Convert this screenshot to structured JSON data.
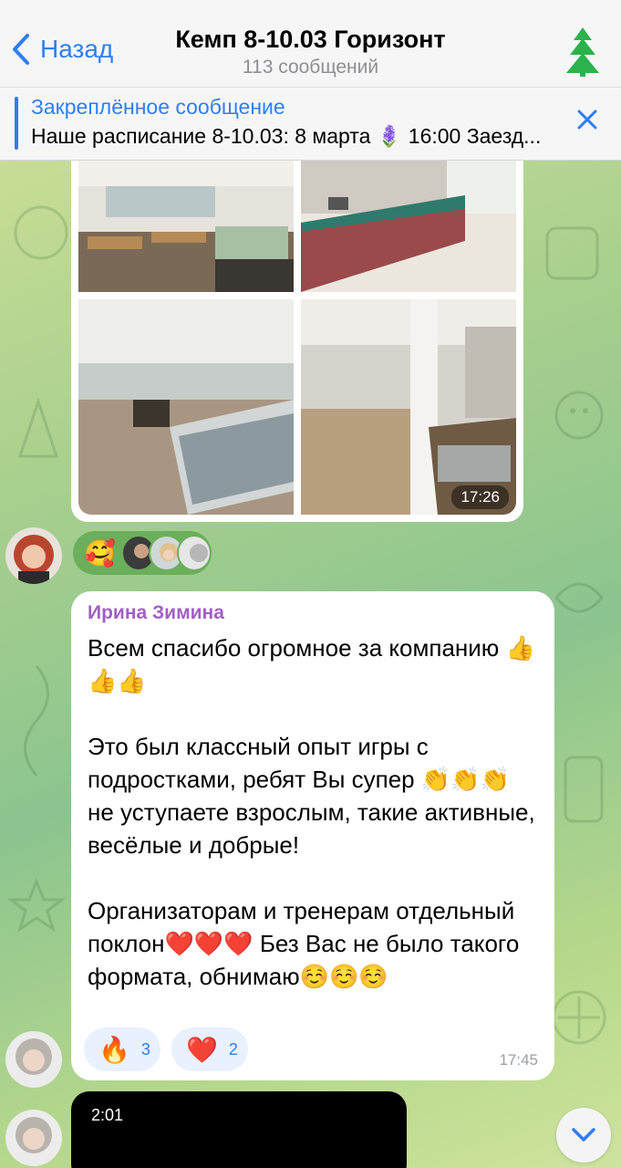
{
  "header": {
    "back_label": "Назад",
    "title": "Кемп 8-10.03 Горизонт",
    "subtitle": "113 сообщений"
  },
  "pinned": {
    "label": "Закреплённое сообщение",
    "text": "Наше расписание 8-10.03: 8 марта 🪻 16:00 Заезд..."
  },
  "album": {
    "time": "17:26"
  },
  "album_reactions": {
    "emoji": "🥰"
  },
  "message": {
    "sender": "Ирина Зимина",
    "text": "Всем спасибо огромное за компанию 👍👍👍\n\nЭто был классный опыт игры с подростками, ребят Вы супер 👏👏👏 не уступаете взрослым, такие активные, весёлые и добрые!\n\nОрганизаторам и тренерам отдельный поклон❤️❤️❤️ Без Вас не было такого формата, обнимаю☺️☺️☺️",
    "time": "17:45",
    "reactions": [
      {
        "emoji": "🔥",
        "count": "3"
      },
      {
        "emoji": "❤️",
        "count": "2"
      }
    ]
  },
  "video": {
    "duration": "2:01"
  },
  "colors": {
    "accent": "#2f7ef5",
    "sender_name": "#a05fc6",
    "reaction_pill": "#6bae5c"
  },
  "icons": {
    "back": "chevron-left-icon",
    "close": "close-icon",
    "scroll": "chevron-down-icon"
  }
}
